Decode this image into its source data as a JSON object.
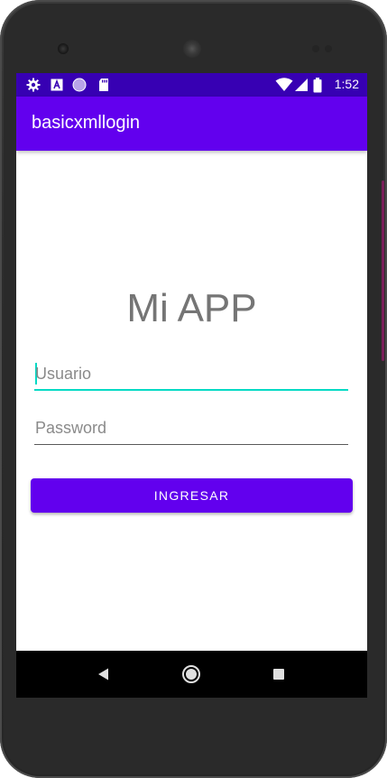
{
  "status_bar": {
    "time": "1:52",
    "left_icons": [
      "gear-icon",
      "font-a-icon",
      "circle-icon",
      "sd-card-icon"
    ],
    "right_icons": [
      "wifi-icon",
      "signal-icon",
      "battery-icon"
    ],
    "background": "#3700b3"
  },
  "app_bar": {
    "title": "basicxmllogin",
    "background": "#6200ee"
  },
  "main": {
    "headline": "Mi APP",
    "username_placeholder": "Usuario",
    "password_placeholder": "Password",
    "login_button": "INGRESAR"
  },
  "colors": {
    "accent": "#03dac5",
    "primary": "#6200ee",
    "primary_dark": "#3700b3"
  },
  "nav_bar": {
    "buttons": [
      "back-icon",
      "home-icon",
      "recents-icon"
    ]
  }
}
